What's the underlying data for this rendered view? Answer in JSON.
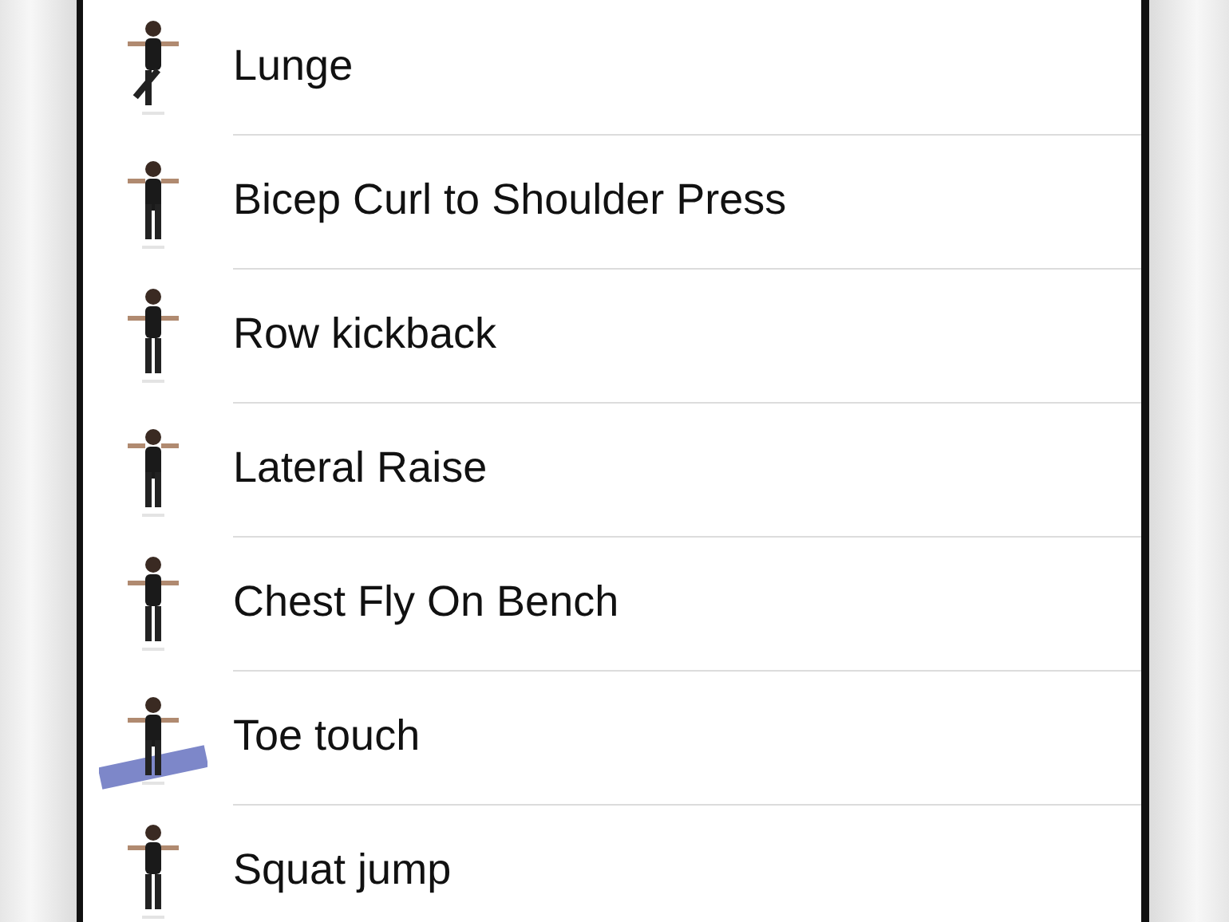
{
  "exercises": [
    {
      "name": "Lunge",
      "kind": "picture"
    },
    {
      "name": "Bicep Curl to Shoulder Press",
      "kind": "picture"
    },
    {
      "name": "Row kickback",
      "kind": "picture"
    },
    {
      "name": "Lateral Raise",
      "kind": "picture"
    },
    {
      "name": "Chest Fly On Bench",
      "kind": "picture"
    },
    {
      "name": "Toe touch",
      "kind": "picture"
    },
    {
      "name": "Squat jump",
      "kind": "picture"
    }
  ]
}
